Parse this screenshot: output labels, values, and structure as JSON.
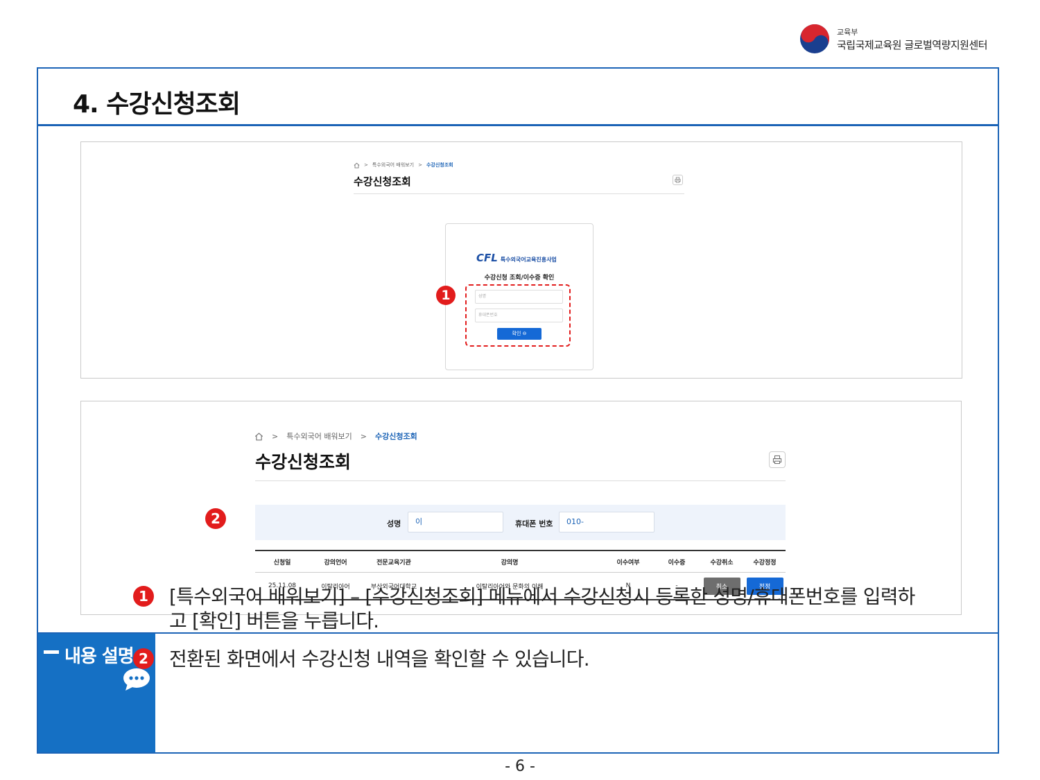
{
  "header": {
    "ministry": "교육부",
    "org": "국립국제교육원 글로벌역량지원센터",
    "logo_icon": "taegeuk-logo-icon"
  },
  "section": {
    "title": "4. 수강신청조회"
  },
  "screenshot1": {
    "breadcrumb": [
      "특수외국어 배워보기",
      "수강신청조회"
    ],
    "page_title": "수강신청조회",
    "brand_mark": "CFL",
    "brand_name": "특수외국어교육진흥사업",
    "card_heading": "수강신청 조회/이수증 확인",
    "name_placeholder": "성명",
    "phone_placeholder": "휴대폰번호",
    "confirm_label": "확인",
    "marker": "❶"
  },
  "screenshot2": {
    "breadcrumb": [
      "특수외국어 배워보기",
      "수강신청조회"
    ],
    "page_title": "수강신청조회",
    "marker": "❷",
    "search": {
      "name_label": "성명",
      "name_value": "이",
      "phone_label": "휴대폰 번호",
      "phone_value": "010-"
    },
    "table": {
      "headers": [
        "신청일",
        "강의언어",
        "전문교육기관",
        "강의명",
        "이수여부",
        "이수증",
        "수강취소",
        "수강정정"
      ],
      "rows": [
        {
          "date": "25.11.08",
          "language": "이탈리아어",
          "institution": "부산외국어대학교",
          "course": "이탈리아어와 문화의 이해",
          "completed": "N",
          "certificate": "-",
          "cancel_label": "취소",
          "edit_label": "정정"
        }
      ]
    }
  },
  "description": {
    "label": "내용 설명",
    "items": [
      {
        "num": "1",
        "text": "[특수외국어 배워보기] – [수강신청조회] 메뉴에서 수강신청시 등록한 성명/휴대폰번호를 입력하고 [확인] 버튼을 누릅니다."
      },
      {
        "num": "2",
        "text": "전환된 화면에서 수강신청 내역을 확인할 수 있습니다."
      }
    ]
  },
  "footer": {
    "page_number": "- 6 -"
  },
  "colors": {
    "accent": "#1b63b6",
    "sidebar": "#1570c4",
    "marker": "#e21c1c",
    "button_blue": "#1569d6",
    "button_gray": "#6e6e6e"
  }
}
